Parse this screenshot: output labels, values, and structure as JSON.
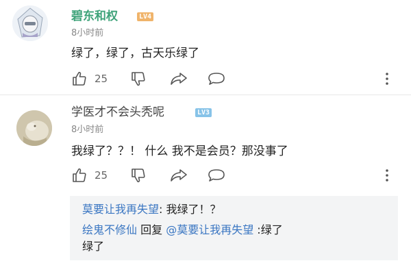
{
  "comments": [
    {
      "username": "碧东和权",
      "level": "LV4",
      "time": "8小时前",
      "text": "绿了，绿了，古天乐绿了",
      "likes": "25"
    },
    {
      "username": "学医才不会头秃呢",
      "level": "LV3",
      "time": "8小时前",
      "text": "我绿了？？！ 什么 我不是会员？那没事了",
      "likes": "25",
      "replies": [
        {
          "author": "莫要让我再失望",
          "sep": ": ",
          "text": "我绿了！？"
        },
        {
          "author": "绘鬼不修仙",
          "action": " 回复 ",
          "target": "@莫要让我再失望",
          "text": " :绿了",
          "text_wrap": "绿了"
        }
      ]
    }
  ],
  "icons": [
    "thumbs-up-icon",
    "thumbs-down-icon",
    "share-icon",
    "reply-icon",
    "more-icon"
  ],
  "colors": {
    "vip_name": "#3fa37a",
    "link_blue": "#3a76c2",
    "lv4": "#f0b46b",
    "lv3": "#87c3e8"
  }
}
